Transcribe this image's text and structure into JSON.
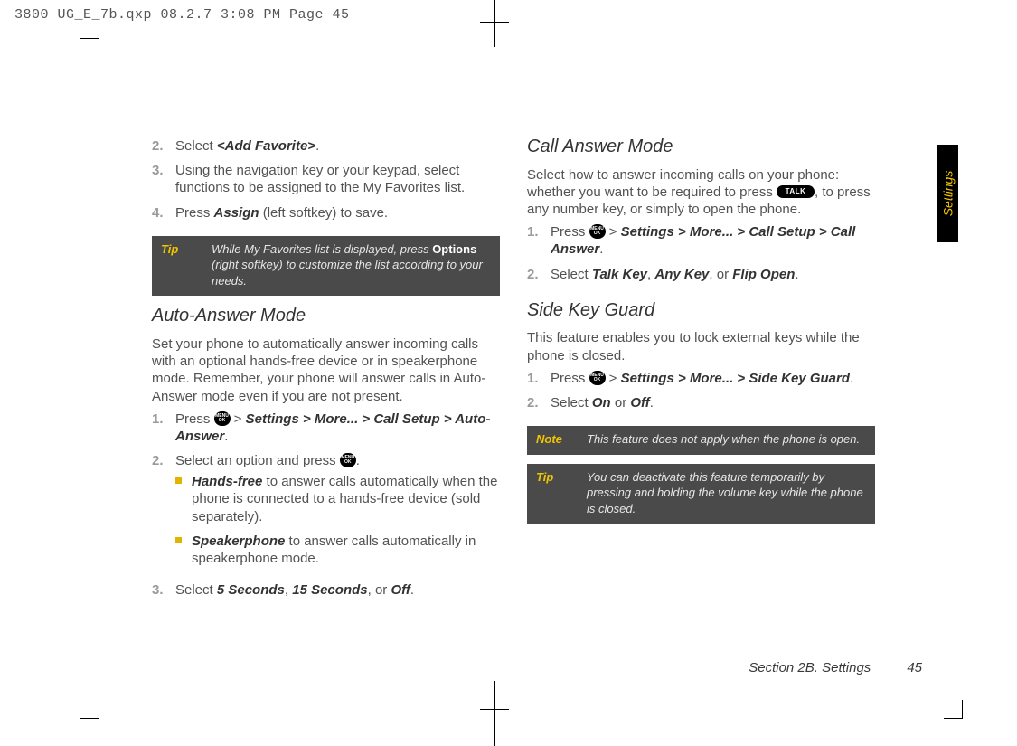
{
  "header": {
    "slugline": "3800 UG_E_7b.qxp  08.2.7  3:08 PM  Page 45"
  },
  "side_tab": "Settings",
  "footer": {
    "section": "Section 2B. Settings",
    "page": "45"
  },
  "left": {
    "steps_a": [
      {
        "num": "2",
        "prefix": "Select ",
        "bi": "<Add Favorite>",
        "suffix": "."
      },
      {
        "num": "3",
        "text": "Using the navigation key or your keypad, select functions to be assigned to the My Favorites list."
      },
      {
        "num": "4",
        "prefix": "Press ",
        "bi": "Assign",
        "suffix": " (left softkey) to save."
      }
    ],
    "tip1": {
      "label": "Tip",
      "pre": "While My Favorites list is displayed, press ",
      "bold": "Options",
      "post": " (right softkey) to customize the list according to your needs."
    },
    "h_auto": "Auto-Answer Mode",
    "auto_desc": "Set your phone to automatically answer incoming calls with an optional hands-free device or in speakerphone mode. Remember, your phone will answer calls in Auto-Answer mode even if you are not present.",
    "steps_b": [
      {
        "num": "1",
        "prefix": "Press ",
        "icon": "menu",
        "mid": " > ",
        "chain": "Settings > More... > Call Setup > Auto-Answer",
        "suffix": "."
      },
      {
        "num": "2",
        "text": "Select an option and press ",
        "icon_after": "menu",
        "tail": "."
      }
    ],
    "bullets": [
      {
        "bi": "Hands-free",
        "rest": " to answer calls automatically when the phone is connected to a hands-free device (sold separately)."
      },
      {
        "bi": "Speakerphone",
        "rest": " to answer calls automatically in speakerphone mode."
      }
    ],
    "step3": {
      "num": "3",
      "prefix": "Select ",
      "a": "5 Seconds",
      "sep1": ", ",
      "b": "15 Seconds",
      "sep2": ", or ",
      "c": "Off",
      "suffix": "."
    }
  },
  "right": {
    "h_call": "Call Answer Mode",
    "call_p1": "Select how to answer incoming calls on your phone: whether you want to be required to press ",
    "call_p2": ", to press any number key, or simply to open the phone.",
    "steps_c": [
      {
        "num": "1",
        "prefix": "Press ",
        "icon": "menu",
        "mid": " > ",
        "chain": "Settings > More... > Call Setup > Call Answer",
        "suffix": "."
      },
      {
        "num": "2",
        "prefix": "Select ",
        "a": "Talk Key",
        "sep1": ", ",
        "b": "Any Key",
        "sep2": ", or ",
        "c": "Flip Open",
        "suffix": "."
      }
    ],
    "h_side": "Side Key Guard",
    "side_desc": "This feature enables you to lock external keys while the phone is closed.",
    "steps_d": [
      {
        "num": "1",
        "prefix": "Press ",
        "icon": "menu",
        "mid": " > ",
        "chain": "Settings > More... > Side Key Guard",
        "suffix": "."
      },
      {
        "num": "2",
        "prefix": "Select ",
        "a": "On",
        "sep": " or ",
        "b": "Off",
        "suffix": "."
      }
    ],
    "note": {
      "label": "Note",
      "text": "This feature does not apply when the phone is open."
    },
    "tip": {
      "label": "Tip",
      "text": "You can deactivate this feature temporarily by pressing and holding the volume key while the phone is closed."
    }
  },
  "icons": {
    "menu_label": "MENU OK",
    "talk_label": "TALK"
  }
}
